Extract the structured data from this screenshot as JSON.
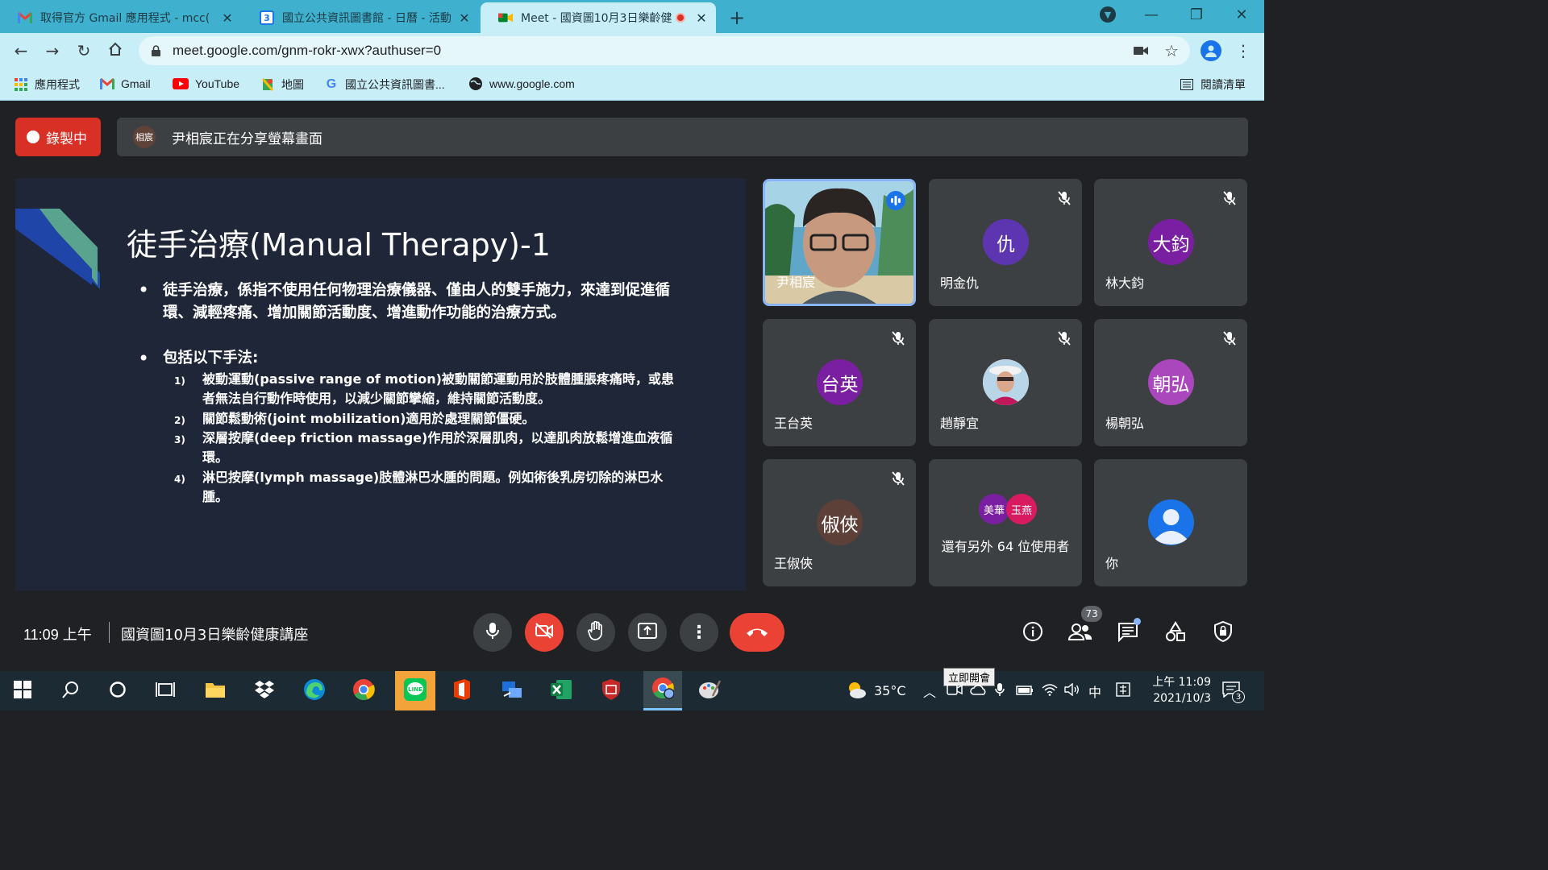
{
  "browser": {
    "tabs": [
      {
        "title": "取得官方 Gmail 應用程式 - mcc(",
        "favicon": "gmail-icon"
      },
      {
        "title": "國立公共資訊圖書館 - 日曆 - 活動",
        "favicon": "calendar-icon",
        "favicon_text": "3"
      },
      {
        "title": "Meet - 國資圖10月3日樂齡健",
        "favicon": "meet-icon",
        "recording": true
      }
    ],
    "url": "meet.google.com/gnm-rokr-xwx?authuser=0",
    "bookmarks": [
      {
        "label": "應用程式",
        "icon": "apps-grid-icon"
      },
      {
        "label": "Gmail",
        "icon": "gmail-icon"
      },
      {
        "label": "YouTube",
        "icon": "youtube-icon"
      },
      {
        "label": "地圖",
        "icon": "maps-icon"
      },
      {
        "label": "國立公共資訊圖書...",
        "icon": "google-icon"
      },
      {
        "label": "www.google.com",
        "icon": "globe-icon"
      }
    ],
    "reading_list": "閱讀清單"
  },
  "meet": {
    "recording_label": "錄製中",
    "presenter_avatar": "相宸",
    "presenter_text": "尹相宸正在分享螢幕畫面",
    "slide": {
      "title": "徒手治療(Manual Therapy)-1",
      "bullet1": "徒手治療，係指不使用任何物理治療儀器、僅由人的雙手施力，來達到促進循環、減輕疼痛、增加關節活動度、增進動作功能的治療方式。",
      "bullet2": "包括以下手法:",
      "items": [
        {
          "num": "1)",
          "text": "被動運動(passive range of motion)被動關節運動用於肢體腫脹疼痛時，或患者無法自行動作時使用，以減少關節攣縮，維持關節活動度。"
        },
        {
          "num": "2)",
          "text": "關節鬆動術(joint mobilization)適用於處理關節僵硬。"
        },
        {
          "num": "3)",
          "text": "深層按摩(deep friction massage)作用於深層肌肉，以達肌肉放鬆增進血液循環。"
        },
        {
          "num": "4)",
          "text": "淋巴按摩(lymph massage)肢體淋巴水腫的問題。例如術後乳房切除的淋巴水腫。"
        }
      ]
    },
    "participants": [
      {
        "name": "尹相宸",
        "type": "video",
        "speaking": true
      },
      {
        "name": "明金仇",
        "initials": "仇",
        "color": "#5e35b1",
        "muted": true
      },
      {
        "name": "林大鈞",
        "initials": "大鈞",
        "color": "#7b1fa2",
        "muted": true
      },
      {
        "name": "王台英",
        "initials": "台英",
        "color": "#7b1fa2",
        "muted": true
      },
      {
        "name": "趙靜宜",
        "type": "photo",
        "muted": true
      },
      {
        "name": "楊朝弘",
        "initials": "朝弘",
        "color": "#ab47bc",
        "muted": true
      },
      {
        "name": "王俶俠",
        "initials": "俶俠",
        "color": "#5d4037",
        "muted": true
      },
      {
        "name": "還有另外 64 位使用者",
        "type": "group",
        "avatars": [
          "美華",
          "玉燕"
        ]
      },
      {
        "name": "你",
        "type": "self"
      }
    ],
    "clock": "11:09 上午",
    "meeting_title": "國資圖10月3日樂齡健康講座",
    "people_count": "73"
  },
  "taskbar": {
    "weather": "35°C",
    "tooltip": "立即開會",
    "ime": "中",
    "time": "上午 11:09",
    "date": "2021/10/3",
    "notifications": "3"
  },
  "colors": {
    "end_call": "#ea4335",
    "meet_bg": "#202124",
    "tile_bg": "#3c4043",
    "chrome_tab": "#3fb1cf"
  }
}
